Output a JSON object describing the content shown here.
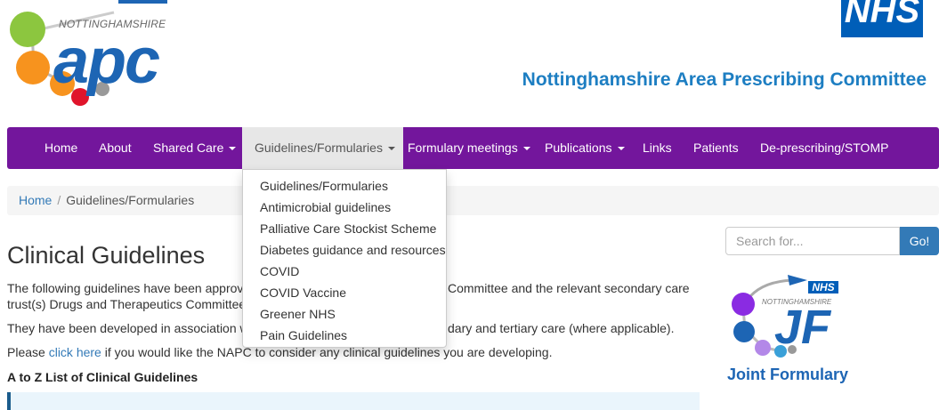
{
  "header": {
    "logo_small": "NOTTINGHAMSHIRE",
    "logo_main": "apc",
    "nhs_badge": "NHS",
    "committee_title": "Nottinghamshire Area Prescribing Committee"
  },
  "nav": {
    "items": [
      {
        "label": "Home",
        "dropdown": false
      },
      {
        "label": "About",
        "dropdown": false
      },
      {
        "label": "Shared Care",
        "dropdown": true
      },
      {
        "label": "Guidelines/Formularies",
        "dropdown": true,
        "active": true
      },
      {
        "label": "Formulary meetings",
        "dropdown": true
      },
      {
        "label": "Publications",
        "dropdown": true
      },
      {
        "label": "Links",
        "dropdown": false
      },
      {
        "label": "Patients",
        "dropdown": false
      },
      {
        "label": "De-prescribing/STOMP",
        "dropdown": false
      }
    ]
  },
  "dropdown": {
    "items": [
      "Guidelines/Formularies",
      "Antimicrobial guidelines",
      "Palliative Care Stockist Scheme",
      "Diabetes guidance and resources",
      "COVID",
      "COVID Vaccine",
      "Greener NHS",
      "Pain Guidelines"
    ]
  },
  "breadcrumb": {
    "home": "Home",
    "separator": "/",
    "current": "Guidelines/Formularies"
  },
  "main": {
    "title": "Clinical Guidelines",
    "para1_line1_a": "The following guidelines have been approved b",
    "para1_line1_b": "Committee and the relevant secondary care",
    "para1_line2": "trust(s) Drugs and Therapeutics Committee(s)",
    "para2_a": "They have been developed in association with",
    "para2_b": "dary and tertiary care (where applicable).",
    "para3_prefix": "Please ",
    "para3_link": "click here",
    "para3_suffix": " if you would like the NAPC to consider any clinical guidelines you are developing.",
    "az_heading": "A to Z List of Clinical Guidelines"
  },
  "sidebar": {
    "search_placeholder": "Search for...",
    "go_label": "Go!",
    "jf_nhs": "NHS",
    "jf_notts": "NOTTINGHAMSHIRE",
    "jf_mark": "JF",
    "jf_caption": "Joint Formulary"
  },
  "colors": {
    "nav_bg": "#73169c",
    "brand_blue": "#1d65b4",
    "link": "#337ab7",
    "nhs_blue": "#005eb8"
  }
}
